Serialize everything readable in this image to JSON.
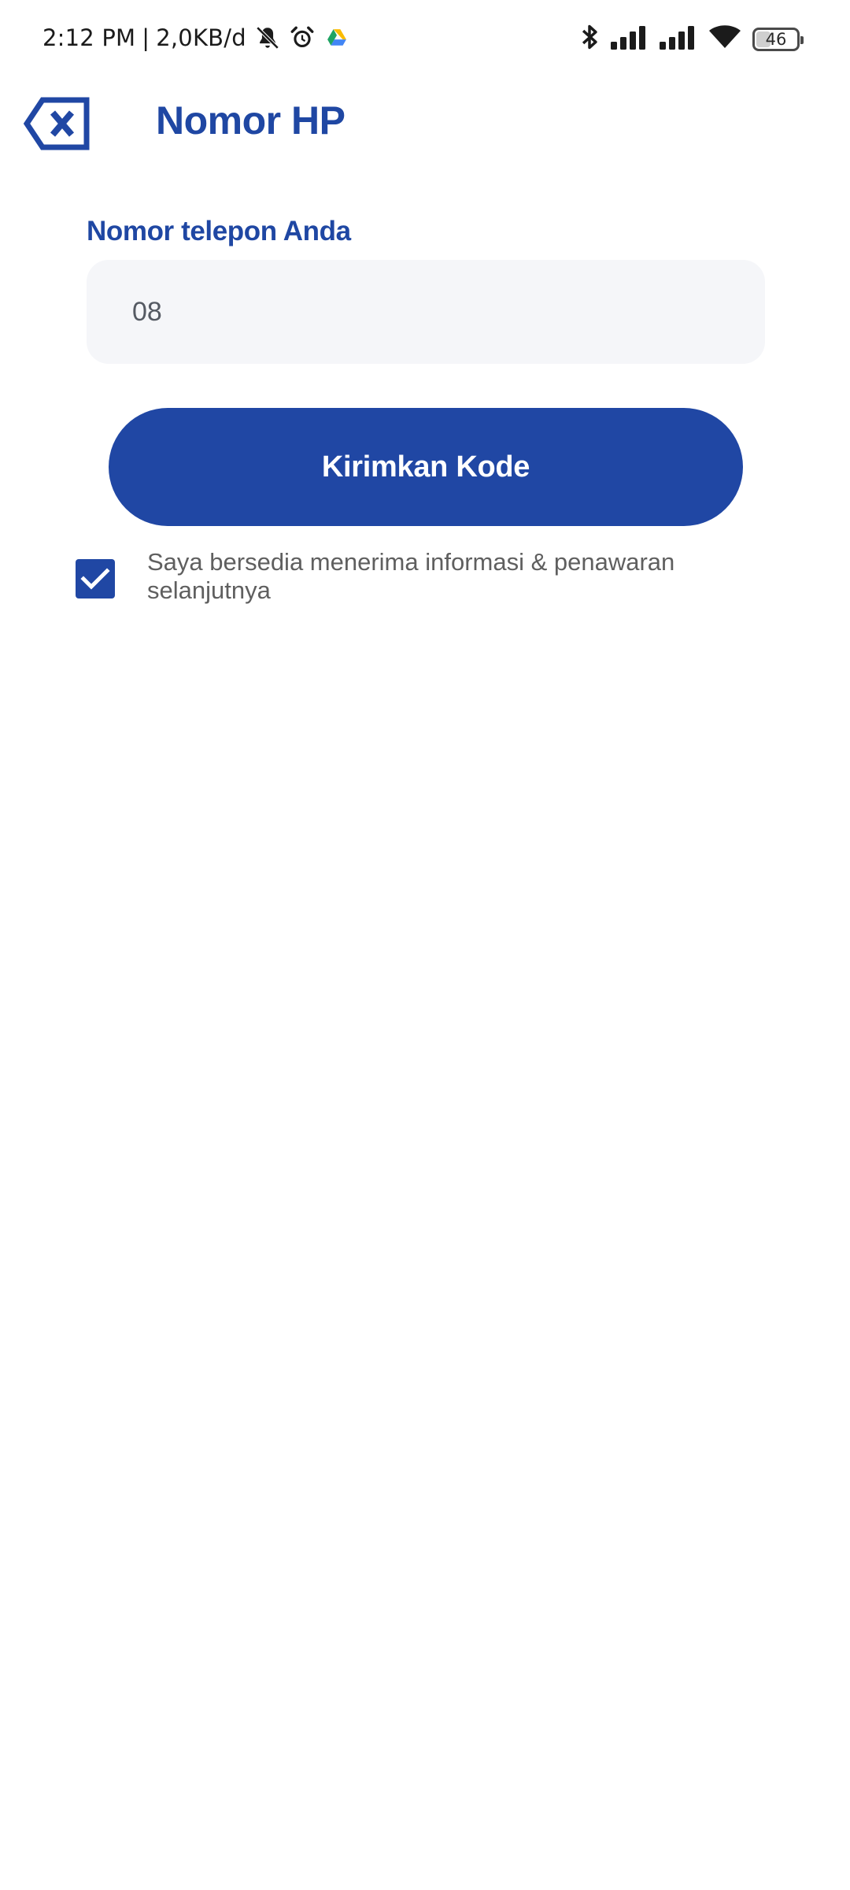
{
  "status_bar": {
    "time": "2:12 PM",
    "separator": "|",
    "network_speed": "2,0KB/d",
    "battery_level": "46",
    "battery_percent": 46,
    "left_icons": [
      "bell-off-icon",
      "alarm-clock-icon",
      "google-drive-icon"
    ],
    "right_icons": [
      "bluetooth-icon",
      "signal-icon",
      "signal-icon",
      "wifi-icon",
      "battery-icon"
    ]
  },
  "header": {
    "back_icon": "backspace-x-icon",
    "title": "Nomor HP"
  },
  "form": {
    "phone_label": "Nomor telepon Anda",
    "phone_value": "08",
    "send_button_label": "Kirimkan Kode"
  },
  "consent": {
    "checked": true,
    "text": "Saya bersedia menerima informasi & penawaran selanjutnya"
  },
  "colors": {
    "primary": "#2047a4",
    "title": "#1f47a3",
    "field_background": "#f5f6f9",
    "body_text": "#5f5f5f"
  }
}
